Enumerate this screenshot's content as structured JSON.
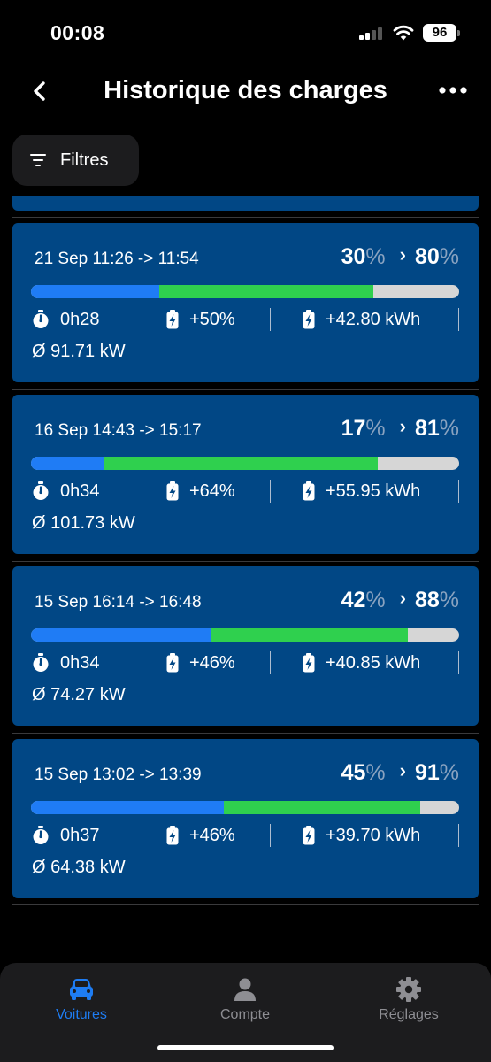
{
  "status_bar": {
    "time": "00:08",
    "battery": "96"
  },
  "header": {
    "title": "Historique des charges"
  },
  "filter": {
    "label": "Filtres"
  },
  "sessions": [
    {
      "date": "21 Sep 11:26 -> 11:54",
      "start_pct": "30",
      "end_pct": "80",
      "pct_unit": "%",
      "start_fraction": 0.3,
      "end_fraction": 0.8,
      "duration": "0h28",
      "added": "+50%",
      "energy": "+42.80 kWh",
      "avg_power": "Ø 91.71 kW"
    },
    {
      "date": "16 Sep 14:43 -> 15:17",
      "start_pct": "17",
      "end_pct": "81",
      "pct_unit": "%",
      "start_fraction": 0.17,
      "end_fraction": 0.81,
      "duration": "0h34",
      "added": "+64%",
      "energy": "+55.95 kWh",
      "avg_power": "Ø 101.73 kW"
    },
    {
      "date": "15 Sep 16:14 -> 16:48",
      "start_pct": "42",
      "end_pct": "88",
      "pct_unit": "%",
      "start_fraction": 0.42,
      "end_fraction": 0.88,
      "duration": "0h34",
      "added": "+46%",
      "energy": "+40.85 kWh",
      "avg_power": "Ø 74.27 kW"
    },
    {
      "date": "15 Sep 13:02 -> 13:39",
      "start_pct": "45",
      "end_pct": "91",
      "pct_unit": "%",
      "start_fraction": 0.45,
      "end_fraction": 0.91,
      "duration": "0h37",
      "added": "+46%",
      "energy": "+39.70 kWh",
      "avg_power": "Ø 64.38 kW"
    }
  ],
  "tabs": [
    {
      "label": "Voitures",
      "icon": "car-icon",
      "active": true
    },
    {
      "label": "Compte",
      "icon": "person-icon",
      "active": false
    },
    {
      "label": "Réglages",
      "icon": "gear-icon",
      "active": false
    }
  ],
  "colors": {
    "card_background": "#014785",
    "bar_start": "#1f7cf5",
    "bar_added": "#2fd04e",
    "bar_remaining": "#d6d6d6",
    "tab_active": "#1e7cf2"
  }
}
